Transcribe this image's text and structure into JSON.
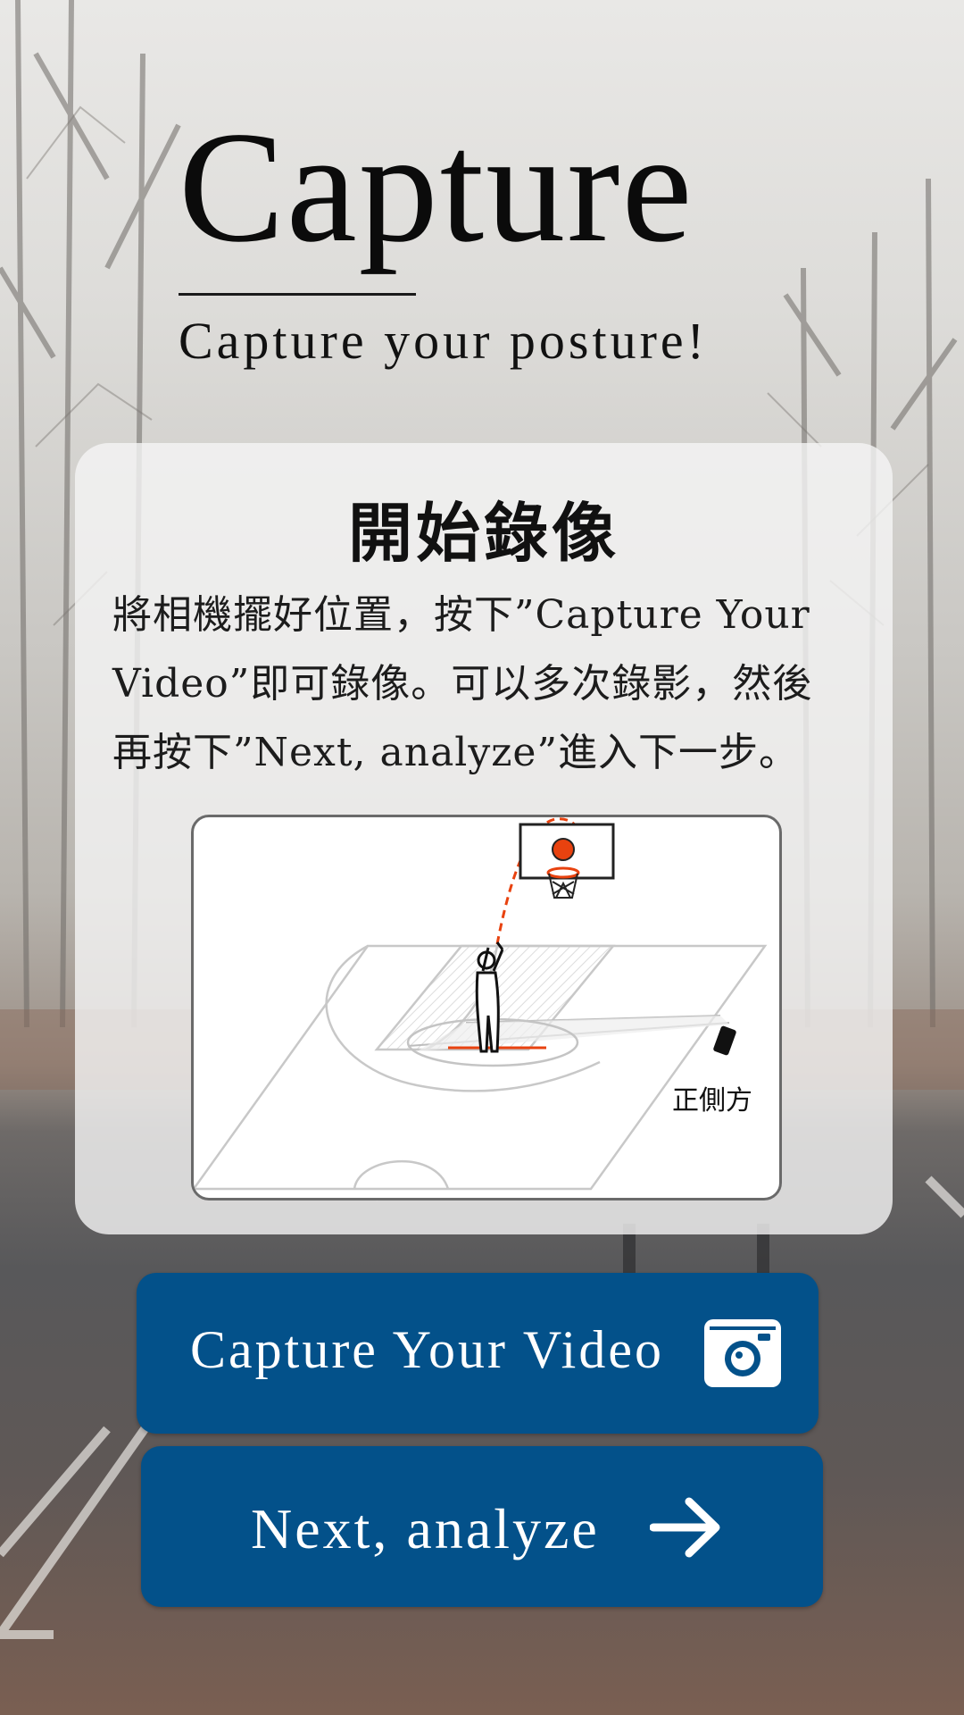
{
  "page": {
    "title": "Capture",
    "subtitle": "Capture your posture!"
  },
  "card": {
    "heading": "開始錄像",
    "instructions": "將相機擺好位置，按下”Capture Your Video”即可錄像。可以多次錄影，然後再按下”Next, analyze”進入下一步。",
    "diagram": {
      "label": "正側方",
      "icons": [
        "basketball-hoop-icon",
        "player-figure-icon",
        "camera-phone-icon"
      ]
    }
  },
  "buttons": {
    "capture": {
      "label": "Capture Your Video",
      "icon": "camera-icon"
    },
    "next": {
      "label": "Next, analyze",
      "icon": "arrow-right-icon"
    }
  },
  "colors": {
    "button_bg": "#03518a",
    "accent_orange": "#e8420f",
    "card_bg": "#f5f5f5"
  }
}
